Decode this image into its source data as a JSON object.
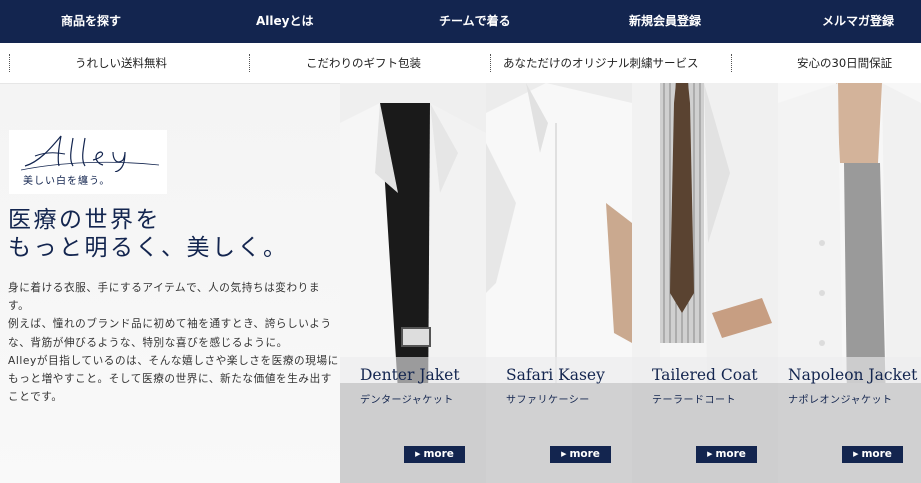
{
  "nav": {
    "items": [
      "商品を探す",
      "Alleyとは",
      "チームで着る",
      "新規会員登録",
      "メルマガ登録"
    ]
  },
  "subnav": {
    "items": [
      "うれしい送料無料",
      "こだわりのギフト包装",
      "あなただけのオリジナル刺繍サービス",
      "安心の30日間保証"
    ]
  },
  "brand": {
    "logo_text": "Alley",
    "tagline": "美しい白を纏う。",
    "color_navy": "#13254f"
  },
  "hero": {
    "headline_line1": "医療の世界を",
    "headline_line2": "もっと明るく、美しく。",
    "body": [
      "身に着ける衣服、手にするアイテムで、人の気持ちは変わります。",
      "例えば、憧れのブランド品に初めて袖を通すとき、誇らしいような、背筋が伸びるような、特別な喜びを感じるように。",
      "Alleyが目指しているのは、そんな嬉しさや楽しさを医療の現場にもっと増やすこと。そして医療の世界に、新たな価値を生み出すことです。"
    ]
  },
  "products": [
    {
      "name": "Denter Jaket",
      "kana": "デンタージャケット",
      "more": "more"
    },
    {
      "name": "Safari Kasey",
      "kana": "サファリケーシー",
      "more": "more"
    },
    {
      "name": "Tailered Coat",
      "kana": "テーラードコート",
      "more": "more"
    },
    {
      "name": "Napoleon Jacket",
      "kana": "ナポレオンジャケット",
      "more": "more"
    }
  ]
}
